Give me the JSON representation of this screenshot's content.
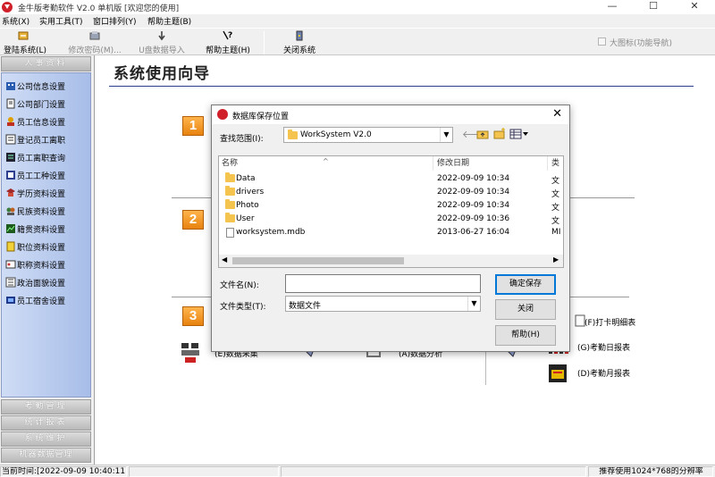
{
  "app": {
    "title": "金牛版考勤软件 V2.0  单机版 [欢迎您的使用]",
    "min_glyph": "—",
    "max_glyph": "☐",
    "close_glyph": "✕"
  },
  "menu": [
    "系统(X)",
    "实用工具(T)",
    "窗口排列(Y)",
    "帮助主题(B)"
  ],
  "toolbar": {
    "buttons": [
      {
        "label": "登陆系统(L)",
        "icon": "login-icon",
        "enabled": true
      },
      {
        "label": "修改密码(M)...",
        "icon": "password-icon",
        "enabled": false
      },
      {
        "label": "U盘数据导入",
        "icon": "usb-import-icon",
        "enabled": false
      },
      {
        "label": "帮助主题(H)",
        "icon": "help-icon",
        "enabled": true
      },
      {
        "label": "关闭系统",
        "icon": "close-system-icon",
        "enabled": true
      }
    ],
    "large_icon_label": "大图标(功能导航)"
  },
  "sidebar": {
    "top_section": "人事资料",
    "items": [
      {
        "label": "公司信息设置",
        "icon": "company-icon"
      },
      {
        "label": "公司部门设置",
        "icon": "department-icon"
      },
      {
        "label": "员工信息设置",
        "icon": "employee-icon"
      },
      {
        "label": "登记员工离职",
        "icon": "resign-icon"
      },
      {
        "label": "员工离职查询",
        "icon": "resign-query-icon"
      },
      {
        "label": "员工工种设置",
        "icon": "job-type-icon"
      },
      {
        "label": "学历资料设置",
        "icon": "education-icon"
      },
      {
        "label": "民族资料设置",
        "icon": "ethnicity-icon"
      },
      {
        "label": "籍贯资料设置",
        "icon": "hometown-icon"
      },
      {
        "label": "职位资料设置",
        "icon": "position-icon"
      },
      {
        "label": "职称资料设置",
        "icon": "title-icon"
      },
      {
        "label": "政治面貌设置",
        "icon": "politics-icon"
      },
      {
        "label": "员工宿舍设置",
        "icon": "dormitory-icon"
      }
    ],
    "bottom_sections": [
      "考勤管理",
      "统计报表",
      "系统维护",
      "机器数据管理"
    ]
  },
  "guide": {
    "title": "系统使用向导",
    "steps": [
      "1",
      "2",
      "3"
    ],
    "items": [
      {
        "label": "(E)数据采集",
        "icon": "data-collect-icon"
      },
      {
        "label": "(A)数据分析",
        "icon": "data-analysis-icon"
      },
      {
        "label": "(F)打卡明细表",
        "icon": "punch-detail-icon"
      },
      {
        "label": "(G)考勤日报表",
        "icon": "daily-report-icon"
      },
      {
        "label": "(D)考勤月报表",
        "icon": "monthly-report-icon"
      }
    ]
  },
  "dialog": {
    "title": "数据库保存位置",
    "lookin_label": "查找范围(I):",
    "lookin_value": "WorkSystem V2.0",
    "back_glyph": "🡐",
    "columns": [
      "名称",
      "修改日期",
      "类"
    ],
    "files": [
      {
        "name": "Data",
        "date": "2022-09-09 10:34",
        "type": "文",
        "kind": "folder"
      },
      {
        "name": "drivers",
        "date": "2022-09-09 10:34",
        "type": "文",
        "kind": "folder"
      },
      {
        "name": "Photo",
        "date": "2022-09-09 10:34",
        "type": "文",
        "kind": "folder"
      },
      {
        "name": "User",
        "date": "2022-09-09 10:36",
        "type": "文",
        "kind": "folder"
      },
      {
        "name": "worksystem.mdb",
        "date": "2013-06-27 16:04",
        "type": "MI",
        "kind": "file"
      }
    ],
    "filename_label": "文件名(N):",
    "filename_value": "",
    "filetype_label": "文件类型(T):",
    "filetype_value": "数据文件",
    "save_button": "确定保存",
    "cancel_button": "关闭",
    "help_button": "帮助(H)"
  },
  "status": {
    "time": "当前时间:[2022-09-09 10:40:11]",
    "hint": "推荐使用1024*768的分辨率"
  },
  "colors": {
    "accent": "#d0202a",
    "nav_bg": "#bccdee",
    "step_orange": "#f0962a",
    "title_line": "#2a3d8c"
  }
}
